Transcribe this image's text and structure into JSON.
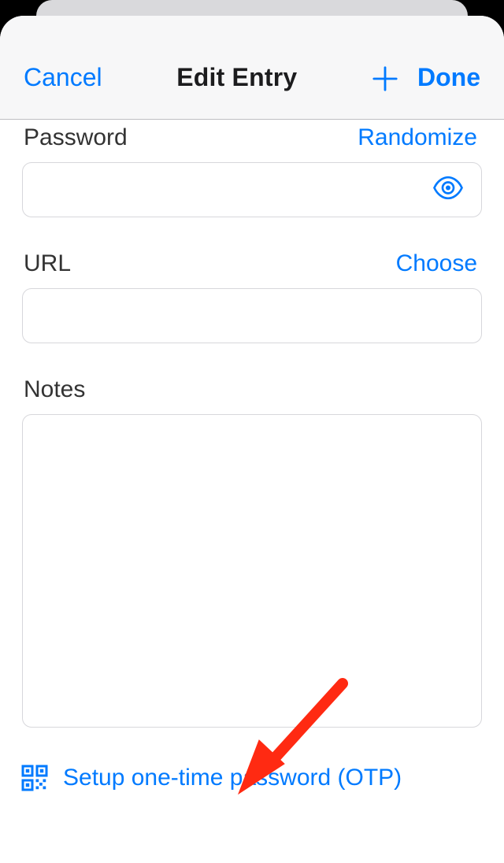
{
  "header": {
    "cancel": "Cancel",
    "title": "Edit Entry",
    "done": "Done"
  },
  "password": {
    "label": "Password",
    "randomize": "Randomize",
    "value": ""
  },
  "url": {
    "label": "URL",
    "choose": "Choose",
    "value": ""
  },
  "notes": {
    "label": "Notes",
    "value": ""
  },
  "otp": {
    "label": "Setup one-time password (OTP)"
  }
}
